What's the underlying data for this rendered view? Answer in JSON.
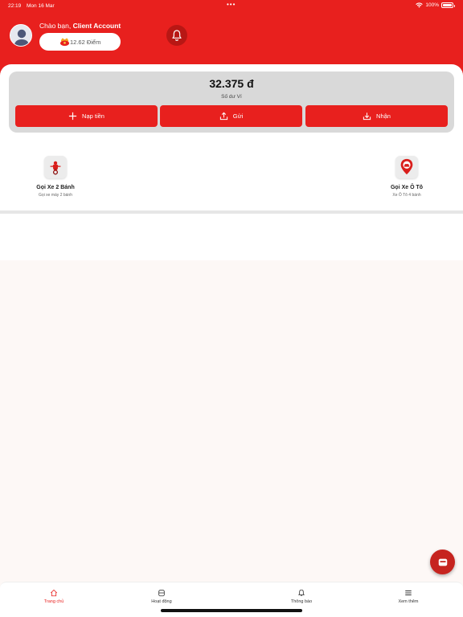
{
  "status_bar": {
    "time": "22:19",
    "date": "Mon 16 Mar",
    "battery": "100%",
    "dots": "•••"
  },
  "header": {
    "greeting_prefix": "Chào bạn, ",
    "user_name": "Client Account",
    "points": "12.62 Điểm"
  },
  "wallet": {
    "balance": "32.375 đ",
    "balance_label": "Số dư Ví",
    "actions": [
      {
        "label": "Nạp tiền",
        "icon": "plus-icon"
      },
      {
        "label": "Gửi",
        "icon": "upload-icon"
      },
      {
        "label": "Nhận",
        "icon": "download-icon"
      }
    ]
  },
  "services": [
    {
      "title": "Gọi Xe 2 Bánh",
      "subtitle": "Gọi xe máy 2 bánh",
      "icon": "scooter-icon"
    },
    {
      "title": "Gọi Xe Ô Tô",
      "subtitle": "Xe Ô Tô 4 bánh",
      "icon": "car-pin-icon"
    }
  ],
  "bottom_nav": [
    {
      "label": "Trang chủ",
      "icon": "home-icon",
      "active": true
    },
    {
      "label": "Hoạt động",
      "icon": "activity-icon",
      "active": false
    },
    {
      "label": "Thông báo",
      "icon": "bell-icon",
      "active": false
    },
    {
      "label": "Xem thêm",
      "icon": "menu-icon",
      "active": false
    }
  ],
  "colors": {
    "brand_red": "#e8201e",
    "dark_red": "#b81714",
    "wallet_card": "#d9d9d9",
    "background": "#fdf8f6"
  }
}
